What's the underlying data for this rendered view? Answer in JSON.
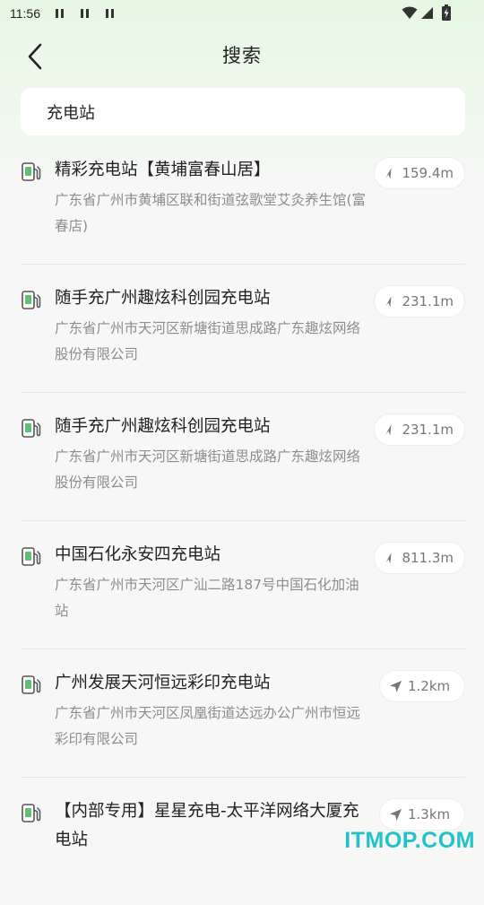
{
  "status_bar": {
    "time": "11:56",
    "notification_icons": [
      "n-icon",
      "n-icon",
      "n-icon"
    ],
    "right_icons": [
      "wifi-icon",
      "signal-icon",
      "battery-charging-icon"
    ]
  },
  "header": {
    "title": "搜索",
    "back_icon": "chevron-left-icon"
  },
  "search": {
    "value": "充电站"
  },
  "results": [
    {
      "title": "精彩充电站【黄埔富春山居】",
      "address": "广东省广州市黄埔区联和街道弦歌堂艾灸养生馆(富春店)",
      "distance": "159.4m",
      "icon": "charging-station-icon",
      "distance_icon": "location-arrow-icon"
    },
    {
      "title": "随手充广州趣炫科创园充电站",
      "address": "广东省广州市天河区新塘街道思成路广东趣炫网络股份有限公司",
      "distance": "231.1m",
      "icon": "charging-station-icon",
      "distance_icon": "location-arrow-icon"
    },
    {
      "title": "随手充广州趣炫科创园充电站",
      "address": "广东省广州市天河区新塘街道思成路广东趣炫网络股份有限公司",
      "distance": "231.1m",
      "icon": "charging-station-icon",
      "distance_icon": "location-arrow-icon"
    },
    {
      "title": "中国石化永安四充电站",
      "address": "广东省广州市天河区广汕二路187号中国石化加油站",
      "distance": "811.3m",
      "icon": "charging-station-icon",
      "distance_icon": "location-arrow-icon"
    },
    {
      "title": "广州发展天河恒远彩印充电站",
      "address": "广东省广州市天河区凤凰街道达远办公广州市恒远彩印有限公司",
      "distance": "1.2km",
      "icon": "charging-station-icon",
      "distance_icon": "location-arrow-icon"
    },
    {
      "title": "【内部专用】星星充电-太平洋网络大厦充电站",
      "address": "",
      "distance": "1.3km",
      "icon": "charging-station-icon",
      "distance_icon": "location-arrow-icon"
    }
  ],
  "watermark": "ITMOP.COM",
  "colors": {
    "header_gradient_top": "#e6f7e3",
    "page_background": "#f7f7f7",
    "title_text": "#222222",
    "address_text": "#8d8d8d",
    "icon_green": "#5fbf72",
    "watermark": "#21c2c8"
  }
}
